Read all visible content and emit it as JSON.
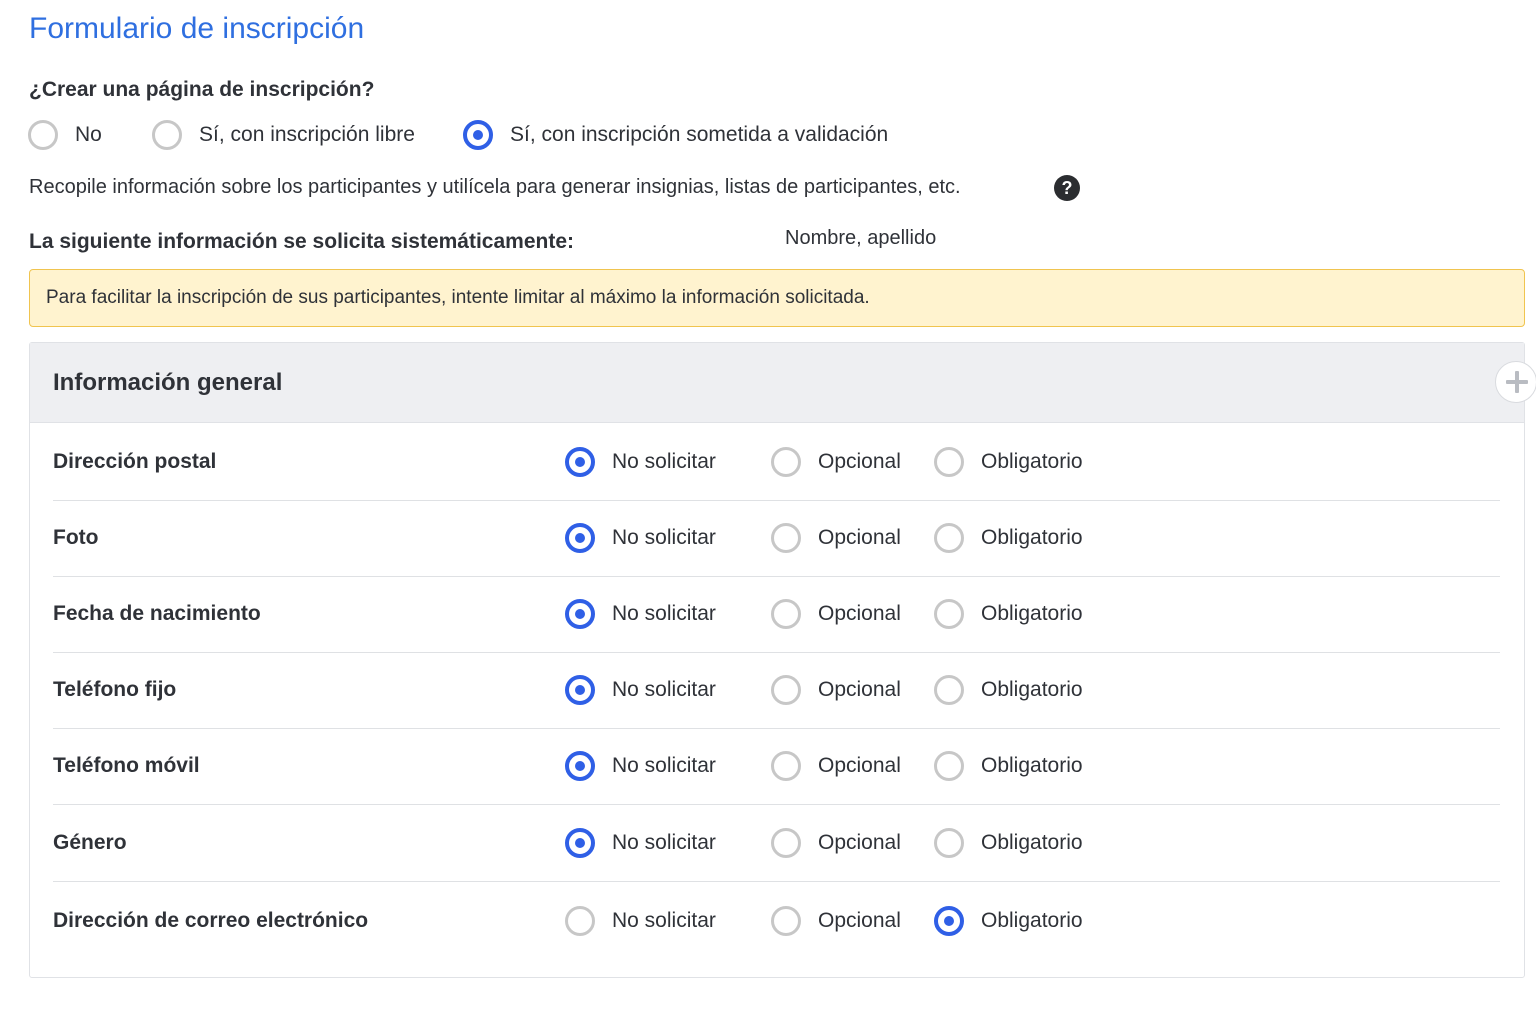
{
  "title": "Formulario de inscripción",
  "registration": {
    "question": "¿Crear una página de inscripción?",
    "options": [
      {
        "label": "No",
        "checked": false
      },
      {
        "label": "Sí, con inscripción libre",
        "checked": false
      },
      {
        "label": "Sí, con inscripción sometida a validación",
        "checked": true
      }
    ],
    "description": "Recopile información sobre los participantes y utilícela para generar insignias, listas de participantes, etc.",
    "help_icon": "?"
  },
  "systematic": {
    "label": "La siguiente información se solicita sistemáticamente:",
    "value": "Nombre, apellido"
  },
  "warning": "Para facilitar la inscripción de sus participantes, intente limitar al máximo la información solicitada.",
  "section": {
    "title": "Información general",
    "add_icon": "plus-icon",
    "choice_labels": [
      "No solicitar",
      "Opcional",
      "Obligatorio"
    ],
    "fields": [
      {
        "label": "Dirección postal",
        "selected": "No solicitar"
      },
      {
        "label": "Foto",
        "selected": "No solicitar"
      },
      {
        "label": "Fecha de nacimiento",
        "selected": "No solicitar"
      },
      {
        "label": "Teléfono fijo",
        "selected": "No solicitar"
      },
      {
        "label": "Teléfono móvil",
        "selected": "No solicitar"
      },
      {
        "label": "Género",
        "selected": "No solicitar"
      },
      {
        "label": "Dirección de correo electrónico",
        "selected": "Obligatorio"
      }
    ]
  },
  "colors": {
    "accent": "#2f5fe6",
    "title": "#2f6fe0",
    "warning_bg": "#fff3cf",
    "warning_border": "#f0c44f"
  }
}
